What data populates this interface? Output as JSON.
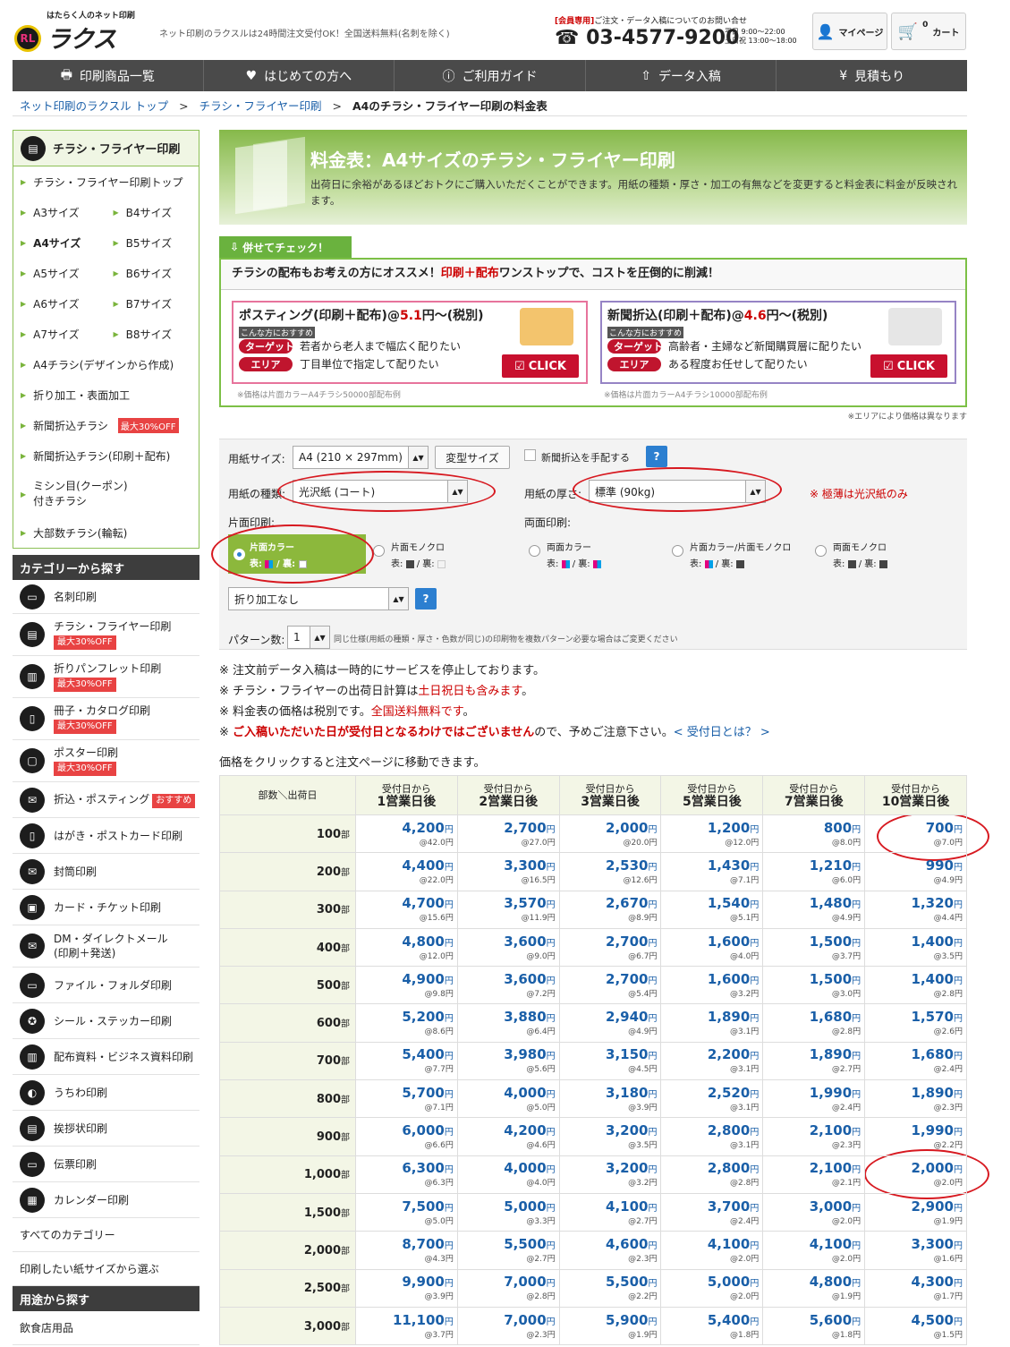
{
  "header": {
    "logo_sub": "はたらく人のネット印刷",
    "logo_name": "ラクスル",
    "tagline": "ネット印刷のラクスルは24時間注文受付OK！全国送料無料(名刺を除く)",
    "tel_label": "[会員専用]",
    "tel_note": "ご注文・データ入稿についてのお問い合せ",
    "phone": "03-4577-9200",
    "hours_weekday": "平日 9:00〜22:00",
    "hours_weekend": "土日祝 13:00〜18:00",
    "mypage": "マイページ",
    "cart": "カート",
    "cart_count": "0"
  },
  "nav": [
    {
      "label": "印刷商品一覧",
      "icon": "printer-icon"
    },
    {
      "label": "はじめての方へ",
      "icon": "heart-icon"
    },
    {
      "label": "ご利用ガイド",
      "icon": "question-icon"
    },
    {
      "label": "データ入稿",
      "icon": "upload-icon"
    },
    {
      "label": "見積もり",
      "icon": "yen-icon"
    }
  ],
  "breadcrumb": {
    "items": [
      "ネット印刷のラクスル トップ",
      "チラシ・フライヤー印刷"
    ],
    "current": "A4のチラシ・フライヤー印刷の料金表"
  },
  "sidebar": {
    "title": "チラシ・フライヤー印刷",
    "top": "チラシ・フライヤー印刷トップ",
    "sizes": [
      [
        "A3サイズ",
        "B4サイズ"
      ],
      [
        "A4サイズ",
        "B5サイズ"
      ],
      [
        "A5サイズ",
        "B6サイズ"
      ],
      [
        "A6サイズ",
        "B7サイズ"
      ],
      [
        "A7サイズ",
        "B8サイズ"
      ]
    ],
    "links": [
      {
        "label": "A4チラシ(デザインから作成)"
      },
      {
        "label": "折り加工・表面加工"
      },
      {
        "label": "新聞折込チラシ",
        "badge": "最大30%OFF"
      },
      {
        "label": "新聞折込チラシ(印刷＋配布)"
      },
      {
        "label": "ミシン目(クーポン)\n付きチラシ"
      },
      {
        "label": "大部数チラシ(輪転)"
      }
    ],
    "category_title": "カテゴリーから探す",
    "categories": [
      {
        "label": "名刺印刷"
      },
      {
        "label": "チラシ・フライヤー印刷",
        "badge": "最大30%OFF"
      },
      {
        "label": "折りパンフレット印刷",
        "badge": "最大30%OFF"
      },
      {
        "label": "冊子・カタログ印刷",
        "badge": "最大30%OFF"
      },
      {
        "label": "ポスター印刷",
        "badge": "最大30%OFF"
      },
      {
        "label": "折込・ポスティング",
        "badge": "おすすめ"
      },
      {
        "label": "はがき・ポストカード印刷"
      },
      {
        "label": "封筒印刷"
      },
      {
        "label": "カード・チケット印刷"
      },
      {
        "label": "DM・ダイレクトメール\n(印刷＋発送)"
      },
      {
        "label": "ファイル・フォルダ印刷"
      },
      {
        "label": "シール・ステッカー印刷"
      },
      {
        "label": "配布資料・ビジネス資料印刷"
      },
      {
        "label": "うちわ印刷"
      },
      {
        "label": "挨拶状印刷"
      },
      {
        "label": "伝票印刷"
      },
      {
        "label": "カレンダー印刷"
      }
    ],
    "all_categories": "すべてのカテゴリー",
    "by_paper": "印刷したい紙サイズから選ぶ",
    "usage_title": "用途から探す",
    "usage_first": "飲食店用品"
  },
  "banner": {
    "title": "料金表：A4サイズのチラシ・フライヤー印刷",
    "desc": "出荷日に余裕があるほどおトクにご購入いただくことができます。用紙の種類・厚さ・加工の有無などを変更すると料金表に料金が反映されます。"
  },
  "check": {
    "tab": "併せてチェック！",
    "headline_a": "チラシの配布もお考えの方にオススメ！",
    "headline_b": "印刷＋配布",
    "headline_c": "ワンストップで、コストを圧倒的に削減！",
    "cards": [
      {
        "title_a": "ポスティング(印刷＋配布)@",
        "price": "5.1",
        "title_b": "円〜(税別)",
        "rec": "こんな方におすすめ",
        "target_label": "ターゲット",
        "target": "若者から老人まで幅広く配りたい",
        "area_label": "エリア",
        "area": "丁目単位で指定して配りたい",
        "button": "CLICK",
        "footnote": "※価格は片面カラーA4チラシ50000部配布例"
      },
      {
        "title_a": "新聞折込(印刷＋配布)@",
        "price": "4.6",
        "title_b": "円〜(税別)",
        "rec": "こんな方におすすめ",
        "target_label": "ターゲット",
        "target": "高齢者・主婦など新聞購買層に配りたい",
        "area_label": "エリア",
        "area": "ある程度お任せして配りたい",
        "button": "CLICK",
        "footnote": "※価格は片面カラーA4チラシ10000部配布例"
      }
    ],
    "area_note": "※エリアにより価格は異なります"
  },
  "form": {
    "size_label": "用紙サイズ:",
    "size_value": "A4 (210 × 297mm)",
    "custom_size": "変型サイズ",
    "newspaper_check": "新聞折込を手配する",
    "paper_type_label": "用紙の種類:",
    "paper_type": "光沢紙 (コート)",
    "thickness_label": "用紙の厚さ:",
    "thickness": "標準 (90kg)",
    "thin_note": "※ 極薄は光沢紙のみ",
    "single_label": "片面印刷:",
    "double_label": "両面印刷:",
    "print_options": [
      {
        "title": "片面カラー",
        "spec": "表:  / 裏: ",
        "selected": true
      },
      {
        "title": "片面モノクロ",
        "spec": "表:  / 裏: "
      },
      {
        "title": "両面カラー",
        "spec": "表:  / 裏: "
      },
      {
        "title": "片面カラー/片面モノクロ",
        "spec": "表:  / 裏: "
      },
      {
        "title": "両面モノクロ",
        "spec": "表:  / 裏: "
      }
    ],
    "fold": "折り加工なし",
    "pattern_label": "パターン数:",
    "pattern_value": "1",
    "pattern_note": "同じ仕様(用紙の種類・厚さ・色数が同じ)の印刷物を複数パターン必要な場合はご変更ください"
  },
  "notes": {
    "n1": "※ 注文前データ入稿は一時的にサービスを停止しております。",
    "n2a": "※ チラシ・フライヤーの出荷日計算は",
    "n2b": "土日祝日も含みます",
    "n2c": "。",
    "n3a": "※ 料金表の価格は税別です。",
    "n3b": "全国送料無料です",
    "n3c": "。",
    "n4a": "※ ",
    "n4b": "ご入稿いただいた日が受付日となるわけではございません",
    "n4c": "ので、予めご注意下さい。",
    "n4d": "< 受付日とは？ >",
    "click": "価格をクリックすると注文ページに移動できます。"
  },
  "table": {
    "corner": "部数＼出荷日",
    "head_top": "受付日から",
    "days": [
      "1営業日後",
      "2営業日後",
      "3営業日後",
      "5営業日後",
      "7営業日後",
      "10営業日後"
    ],
    "qty_unit": "部",
    "yen": "円",
    "rows": [
      {
        "q": "100",
        "p": [
          [
            "4,200",
            "@42.0円"
          ],
          [
            "2,700",
            "@27.0円"
          ],
          [
            "2,000",
            "@20.0円"
          ],
          [
            "1,200",
            "@12.0円"
          ],
          [
            "800",
            "@8.0円"
          ],
          [
            "700",
            "@7.0円"
          ]
        ]
      },
      {
        "q": "200",
        "p": [
          [
            "4,400",
            "@22.0円"
          ],
          [
            "3,300",
            "@16.5円"
          ],
          [
            "2,530",
            "@12.6円"
          ],
          [
            "1,430",
            "@7.1円"
          ],
          [
            "1,210",
            "@6.0円"
          ],
          [
            "990",
            "@4.9円"
          ]
        ]
      },
      {
        "q": "300",
        "p": [
          [
            "4,700",
            "@15.6円"
          ],
          [
            "3,570",
            "@11.9円"
          ],
          [
            "2,670",
            "@8.9円"
          ],
          [
            "1,540",
            "@5.1円"
          ],
          [
            "1,480",
            "@4.9円"
          ],
          [
            "1,320",
            "@4.4円"
          ]
        ]
      },
      {
        "q": "400",
        "p": [
          [
            "4,800",
            "@12.0円"
          ],
          [
            "3,600",
            "@9.0円"
          ],
          [
            "2,700",
            "@6.7円"
          ],
          [
            "1,600",
            "@4.0円"
          ],
          [
            "1,500",
            "@3.7円"
          ],
          [
            "1,400",
            "@3.5円"
          ]
        ]
      },
      {
        "q": "500",
        "p": [
          [
            "4,900",
            "@9.8円"
          ],
          [
            "3,600",
            "@7.2円"
          ],
          [
            "2,700",
            "@5.4円"
          ],
          [
            "1,600",
            "@3.2円"
          ],
          [
            "1,500",
            "@3.0円"
          ],
          [
            "1,400",
            "@2.8円"
          ]
        ]
      },
      {
        "q": "600",
        "p": [
          [
            "5,200",
            "@8.6円"
          ],
          [
            "3,880",
            "@6.4円"
          ],
          [
            "2,940",
            "@4.9円"
          ],
          [
            "1,890",
            "@3.1円"
          ],
          [
            "1,680",
            "@2.8円"
          ],
          [
            "1,570",
            "@2.6円"
          ]
        ]
      },
      {
        "q": "700",
        "p": [
          [
            "5,400",
            "@7.7円"
          ],
          [
            "3,980",
            "@5.6円"
          ],
          [
            "3,150",
            "@4.5円"
          ],
          [
            "2,200",
            "@3.1円"
          ],
          [
            "1,890",
            "@2.7円"
          ],
          [
            "1,680",
            "@2.4円"
          ]
        ]
      },
      {
        "q": "800",
        "p": [
          [
            "5,700",
            "@7.1円"
          ],
          [
            "4,000",
            "@5.0円"
          ],
          [
            "3,180",
            "@3.9円"
          ],
          [
            "2,520",
            "@3.1円"
          ],
          [
            "1,990",
            "@2.4円"
          ],
          [
            "1,890",
            "@2.3円"
          ]
        ]
      },
      {
        "q": "900",
        "p": [
          [
            "6,000",
            "@6.6円"
          ],
          [
            "4,200",
            "@4.6円"
          ],
          [
            "3,200",
            "@3.5円"
          ],
          [
            "2,800",
            "@3.1円"
          ],
          [
            "2,100",
            "@2.3円"
          ],
          [
            "1,990",
            "@2.2円"
          ]
        ]
      },
      {
        "q": "1,000",
        "p": [
          [
            "6,300",
            "@6.3円"
          ],
          [
            "4,000",
            "@4.0円"
          ],
          [
            "3,200",
            "@3.2円"
          ],
          [
            "2,800",
            "@2.8円"
          ],
          [
            "2,100",
            "@2.1円"
          ],
          [
            "2,000",
            "@2.0円"
          ]
        ]
      },
      {
        "q": "1,500",
        "p": [
          [
            "7,500",
            "@5.0円"
          ],
          [
            "5,000",
            "@3.3円"
          ],
          [
            "4,100",
            "@2.7円"
          ],
          [
            "3,700",
            "@2.4円"
          ],
          [
            "3,000",
            "@2.0円"
          ],
          [
            "2,900",
            "@1.9円"
          ]
        ]
      },
      {
        "q": "2,000",
        "p": [
          [
            "8,700",
            "@4.3円"
          ],
          [
            "5,500",
            "@2.7円"
          ],
          [
            "4,600",
            "@2.3円"
          ],
          [
            "4,100",
            "@2.0円"
          ],
          [
            "4,100",
            "@2.0円"
          ],
          [
            "3,300",
            "@1.6円"
          ]
        ]
      },
      {
        "q": "2,500",
        "p": [
          [
            "9,900",
            "@3.9円"
          ],
          [
            "7,000",
            "@2.8円"
          ],
          [
            "5,500",
            "@2.2円"
          ],
          [
            "5,000",
            "@2.0円"
          ],
          [
            "4,800",
            "@1.9円"
          ],
          [
            "4,300",
            "@1.7円"
          ]
        ]
      },
      {
        "q": "3,000",
        "p": [
          [
            "11,100",
            "@3.7円"
          ],
          [
            "7,000",
            "@2.3円"
          ],
          [
            "5,900",
            "@1.9円"
          ],
          [
            "5,400",
            "@1.8円"
          ],
          [
            "5,600",
            "@1.8円"
          ],
          [
            "4,500",
            "@1.5円"
          ]
        ]
      }
    ]
  },
  "colors": {
    "accent_green": "#7cc046",
    "price_blue": "#1a5fa8",
    "alert_red": "#c00",
    "annotation_red": "#d71920"
  }
}
